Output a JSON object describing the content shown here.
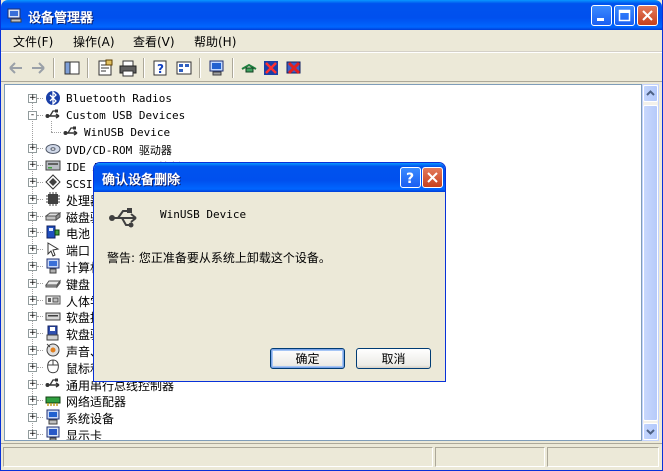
{
  "window": {
    "title": "设备管理器",
    "menu": [
      "文件(F)",
      "操作(A)",
      "查看(V)",
      "帮助(H)"
    ]
  },
  "tree": [
    {
      "label": "Bluetooth Radios",
      "icon": "bluetooth-icon",
      "expand": "+"
    },
    {
      "label": "Custom USB Devices",
      "icon": "usb-icon",
      "expand": "-"
    },
    {
      "label": "WinUSB Device",
      "icon": "usb-icon",
      "child": true
    },
    {
      "label": "DVD/CD-ROM 驱动器",
      "icon": "cdrom-icon",
      "expand": "+"
    },
    {
      "label": "IDE ATA/ATAPI 控制器",
      "icon": "ide-icon",
      "expand": "+"
    },
    {
      "label": "SCSI 和 RAID 控制器",
      "icon": "scsi-icon",
      "expand": "+"
    },
    {
      "label": "处理器",
      "icon": "cpu-icon",
      "expand": "+"
    },
    {
      "label": "磁盘驱动器",
      "icon": "disk-icon",
      "expand": "+"
    },
    {
      "label": "电池",
      "icon": "battery-icon",
      "expand": "+"
    },
    {
      "label": "端口 (COM 和 LPT)",
      "icon": "port-icon",
      "expand": "+"
    },
    {
      "label": "计算机",
      "icon": "computer-icon",
      "expand": "+"
    },
    {
      "label": "键盘",
      "icon": "keyboard-icon",
      "expand": "+"
    },
    {
      "label": "人体学输入设备",
      "icon": "hid-icon",
      "expand": "+"
    },
    {
      "label": "软盘控制器",
      "icon": "floppy-controller-icon",
      "expand": "+"
    },
    {
      "label": "软盘驱动器",
      "icon": "floppy-icon",
      "expand": "+"
    },
    {
      "label": "声音、视频和游戏控制器",
      "icon": "sound-icon",
      "expand": "+"
    },
    {
      "label": "鼠标和其它指针设备",
      "icon": "mouse-icon",
      "expand": "+"
    },
    {
      "label": "通用串行总线控制器",
      "icon": "usb-icon",
      "expand": "+"
    },
    {
      "label": "网络适配器",
      "icon": "network-icon",
      "expand": "+"
    },
    {
      "label": "系统设备",
      "icon": "system-icon",
      "expand": "+"
    },
    {
      "label": "显示卡",
      "icon": "display-icon",
      "expand": "+"
    }
  ],
  "dialog": {
    "title": "确认设备删除",
    "device_name": "WinUSB Device",
    "warning": "警告: 您正准备要从系统上卸载这个设备。",
    "ok_label": "确定",
    "cancel_label": "取消",
    "help_glyph": "?"
  },
  "colors": {
    "title_blue": "#0053ee",
    "close_red": "#c7401d",
    "window_bg": "#ece9d8"
  }
}
